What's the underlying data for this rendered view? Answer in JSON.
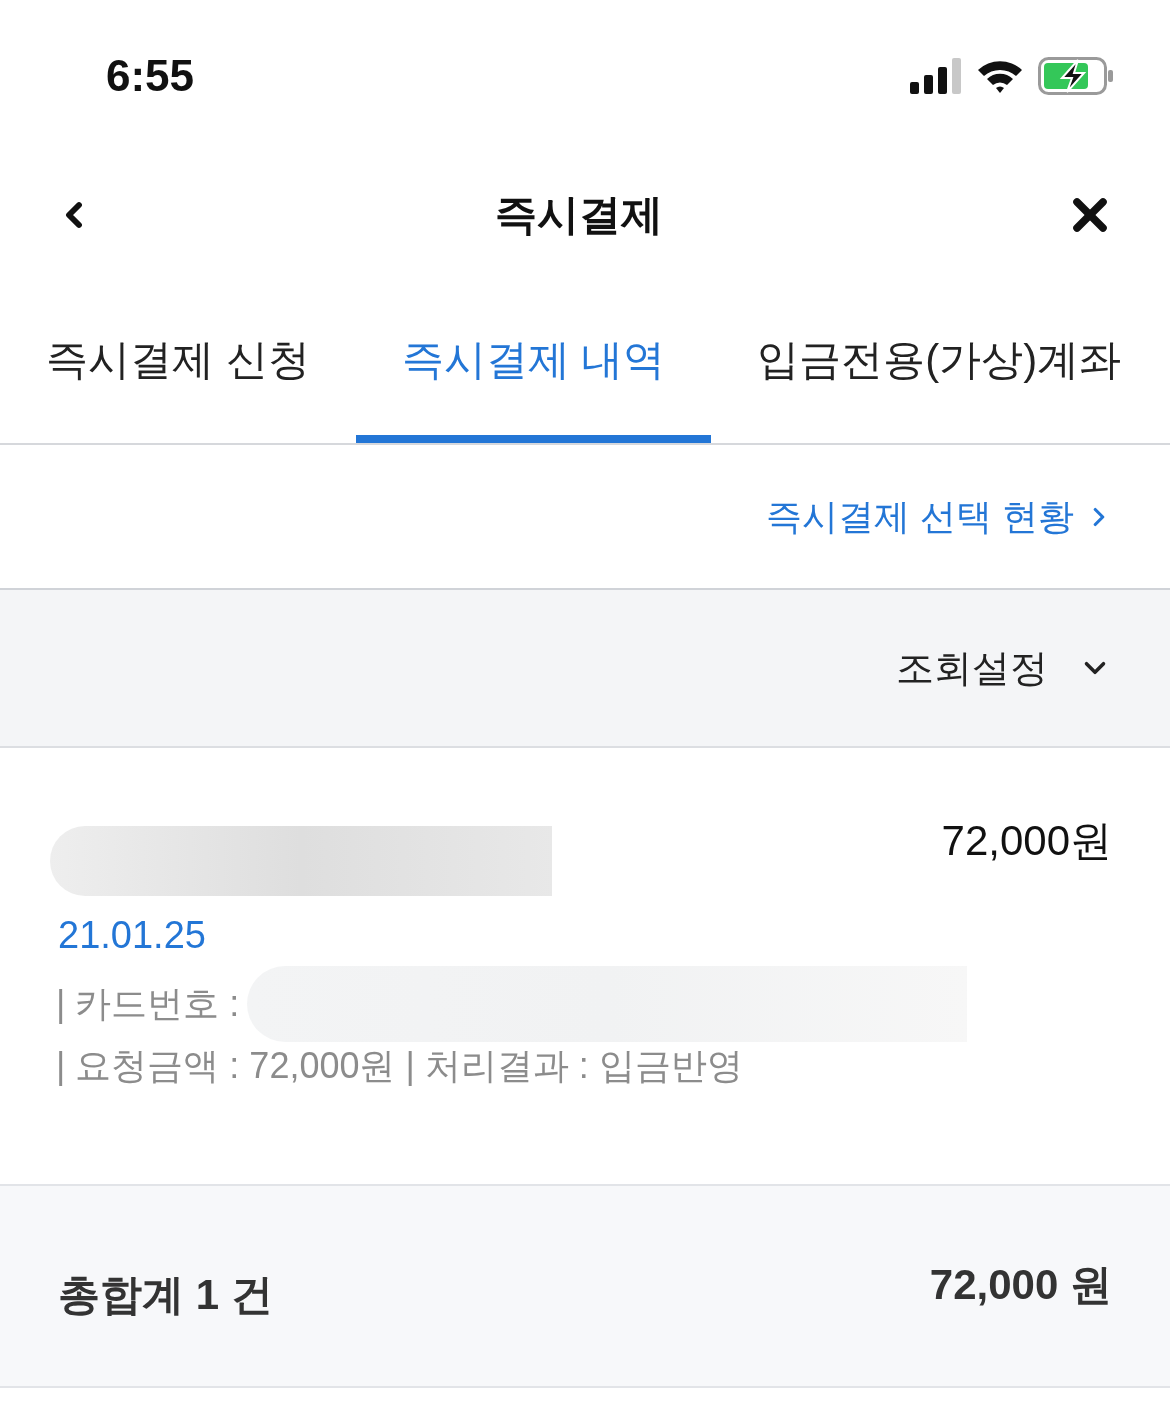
{
  "status_bar": {
    "time": "6:55"
  },
  "header": {
    "title": "즉시결제"
  },
  "tabs": [
    {
      "label": "즉시결제 신청",
      "selected": false
    },
    {
      "label": "즉시결제 내역",
      "selected": true
    },
    {
      "label": "입금전용(가상)계좌",
      "selected": false
    }
  ],
  "link": {
    "label": "즉시결제 선택 현황"
  },
  "filter": {
    "label": "조회설정",
    "expanded": false
  },
  "transactions": [
    {
      "amount": "72,000원",
      "date": "21.01.25",
      "card_label": "| 카드번호 :",
      "details": "| 요청금액 : 72,000원 | 처리결과 : 입금반영"
    }
  ],
  "summary": {
    "count_label": "총합계 1 건",
    "total": "72,000 원"
  }
}
